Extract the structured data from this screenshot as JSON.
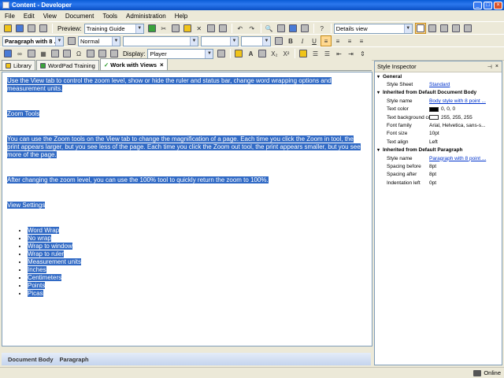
{
  "window": {
    "title": "Content - Developer"
  },
  "menu": [
    "File",
    "Edit",
    "View",
    "Document",
    "Tools",
    "Administration",
    "Help"
  ],
  "toolbar1": {
    "preview_label": "Preview:",
    "preview_value": "Training Guide",
    "view_mode_value": "Details view"
  },
  "toolbar2": {
    "paragraph_style": "Paragraph with 8 ...",
    "character_style": "Normal",
    "bold_label": "B",
    "italic_label": "I",
    "underline_label": "U"
  },
  "toolbar3": {
    "display_label": "Display:",
    "display_value": "Player",
    "subscript_label": "X₂",
    "superscript_label": "X²"
  },
  "tabs": [
    {
      "label": "Library",
      "active": false
    },
    {
      "label": "WordPad Training",
      "active": false
    },
    {
      "label": "Work with Views",
      "active": true
    }
  ],
  "editor": {
    "paragraphs": [
      "Use the View tab to control the zoom level, show or hide the ruler and status bar, change word wrapping options and measurement units.",
      "Zoom Tools",
      "You can use the Zoom tools on the View tab to change the magnification of a page. Each time you click the Zoom in tool, the print appears larger, but you see less of the page. Each time you click the Zoom out tool, the print appears smaller, but you see more of the page.",
      "After changing the zoom level, you can use the 100% tool to quickly return the zoom to 100%.",
      "View Settings"
    ],
    "bullets": [
      "Word Wrap",
      "No wrap",
      "Wrap to window",
      "Wrap to ruler",
      "Measurement units",
      "Inches",
      "Centimeters",
      "Points",
      "Picas"
    ]
  },
  "pathbar": {
    "items": [
      "Document Body",
      "Paragraph"
    ]
  },
  "inspector": {
    "title": "Style Inspector",
    "groups": [
      {
        "title": "General",
        "rows": [
          {
            "key": "Style Sheet",
            "value": "Standard",
            "link": true
          }
        ]
      },
      {
        "title": "Inherited from Default Document Body",
        "rows": [
          {
            "key": "Style name",
            "value": "Body style with 8 point ...",
            "link": true
          },
          {
            "key": "Text color",
            "value": "0, 0, 0",
            "swatch": "#000000"
          },
          {
            "key": "Text background color",
            "value": "255, 255, 255",
            "swatch": "#ffffff"
          },
          {
            "key": "Font family",
            "value": "Arial, Helvetica, sans-s..."
          },
          {
            "key": "Font size",
            "value": "10pt"
          },
          {
            "key": "Text align",
            "value": "Left"
          }
        ]
      },
      {
        "title": "Inherited from Default Paragraph",
        "rows": [
          {
            "key": "Style name",
            "value": "Paragraph with 8 point ...",
            "link": true
          },
          {
            "key": "Spacing before",
            "value": "8pt"
          },
          {
            "key": "Spacing after",
            "value": "8pt"
          },
          {
            "key": "Indentation left",
            "value": "0pt"
          }
        ]
      }
    ]
  },
  "status": {
    "connection": "Online"
  },
  "colors": {
    "selection": "#316ac5",
    "titlebar": "#0a5bd6",
    "link": "#0033cc"
  }
}
